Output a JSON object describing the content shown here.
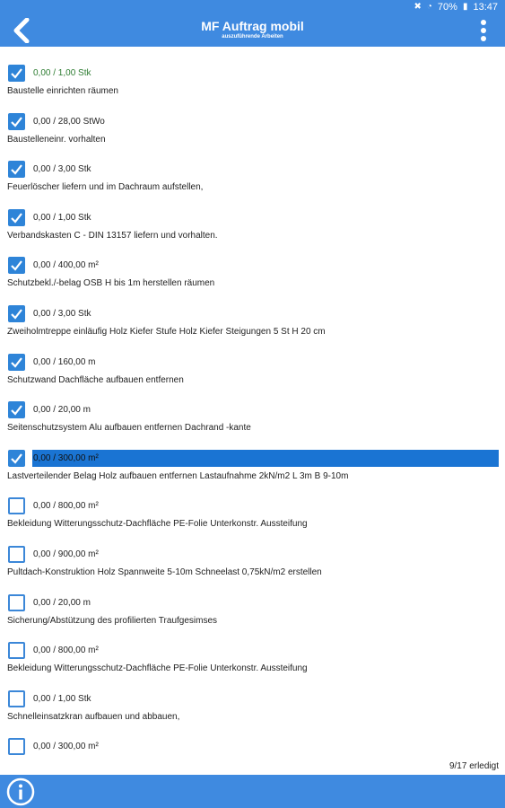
{
  "status_bar": {
    "battery": "70%",
    "time": "13:47"
  },
  "header": {
    "title": "MF Auftrag mobil",
    "subtitle": "auszuführende Arbeiten"
  },
  "tasks": [
    {
      "qty": "0,00 / 1,00 Stk",
      "desc": "Baustelle einrichten räumen",
      "checked": true,
      "qty_color": "#2e7d32"
    },
    {
      "qty": "0,00 / 28,00 StWo",
      "desc": "Baustelleneinr. vorhalten",
      "checked": true
    },
    {
      "qty": "0,00 / 3,00 Stk",
      "desc": "Feuerlöscher liefern und im Dachraum aufstellen,",
      "checked": true
    },
    {
      "qty": "0,00 / 1,00 Stk",
      "desc": "Verbandskasten C - DIN 13157 liefern und vorhalten.",
      "checked": true
    },
    {
      "qty": "0,00 / 400,00 m²",
      "desc": "Schutzbekl./-belag OSB H bis 1m herstellen räumen",
      "checked": true
    },
    {
      "qty": "0,00 / 3,00 Stk",
      "desc": "Zweiholmtreppe einläufig Holz Kiefer Stufe Holz Kiefer Steigungen 5 St H 20 cm",
      "checked": true
    },
    {
      "qty": "0,00 / 160,00 m",
      "desc": "Schutzwand Dachfläche aufbauen entfernen",
      "checked": true
    },
    {
      "qty": "0,00 / 20,00 m",
      "desc": "Seitenschutzsystem Alu aufbauen entfernen Dachrand -kante",
      "checked": true
    },
    {
      "qty": "0,00 / 300,00 m²",
      "desc": "Lastverteilender Belag Holz aufbauen entfernen Lastaufnahme 2kN/m2 L 3m B 9-10m",
      "checked": true,
      "selected": true
    },
    {
      "qty": "0,00 / 800,00 m²",
      "desc": "Bekleidung Witterungsschutz-Dachfläche PE-Folie Unterkonstr. Aussteifung",
      "checked": false
    },
    {
      "qty": "0,00 / 900,00 m²",
      "desc": "Pultdach-Konstruktion Holz Spannweite 5-10m Schneelast 0,75kN/m2 erstellen",
      "checked": false
    },
    {
      "qty": "0,00 / 20,00 m",
      "desc": "Sicherung/Abstützung des profilierten Traufgesimses",
      "checked": false
    },
    {
      "qty": "0,00 / 800,00 m²",
      "desc": "Bekleidung Witterungsschutz-Dachfläche PE-Folie Unterkonstr. Aussteifung",
      "checked": false
    },
    {
      "qty": "0,00 / 1,00 Stk",
      "desc": "Schnelleinsatzkran aufbauen und abbauen,",
      "checked": false
    },
    {
      "qty": "0,00 / 300,00 m²",
      "desc": "",
      "checked": false
    }
  ],
  "done_count": "9/17 erledigt",
  "colors": {
    "primary": "#3f8ae0",
    "checkbox": "#2e84d8",
    "selection": "#1a74d3",
    "first_qty": "#2e7d32"
  },
  "icons": {
    "back": "chevron-left-icon",
    "menu": "more-vertical-icon",
    "info": "info-icon"
  }
}
